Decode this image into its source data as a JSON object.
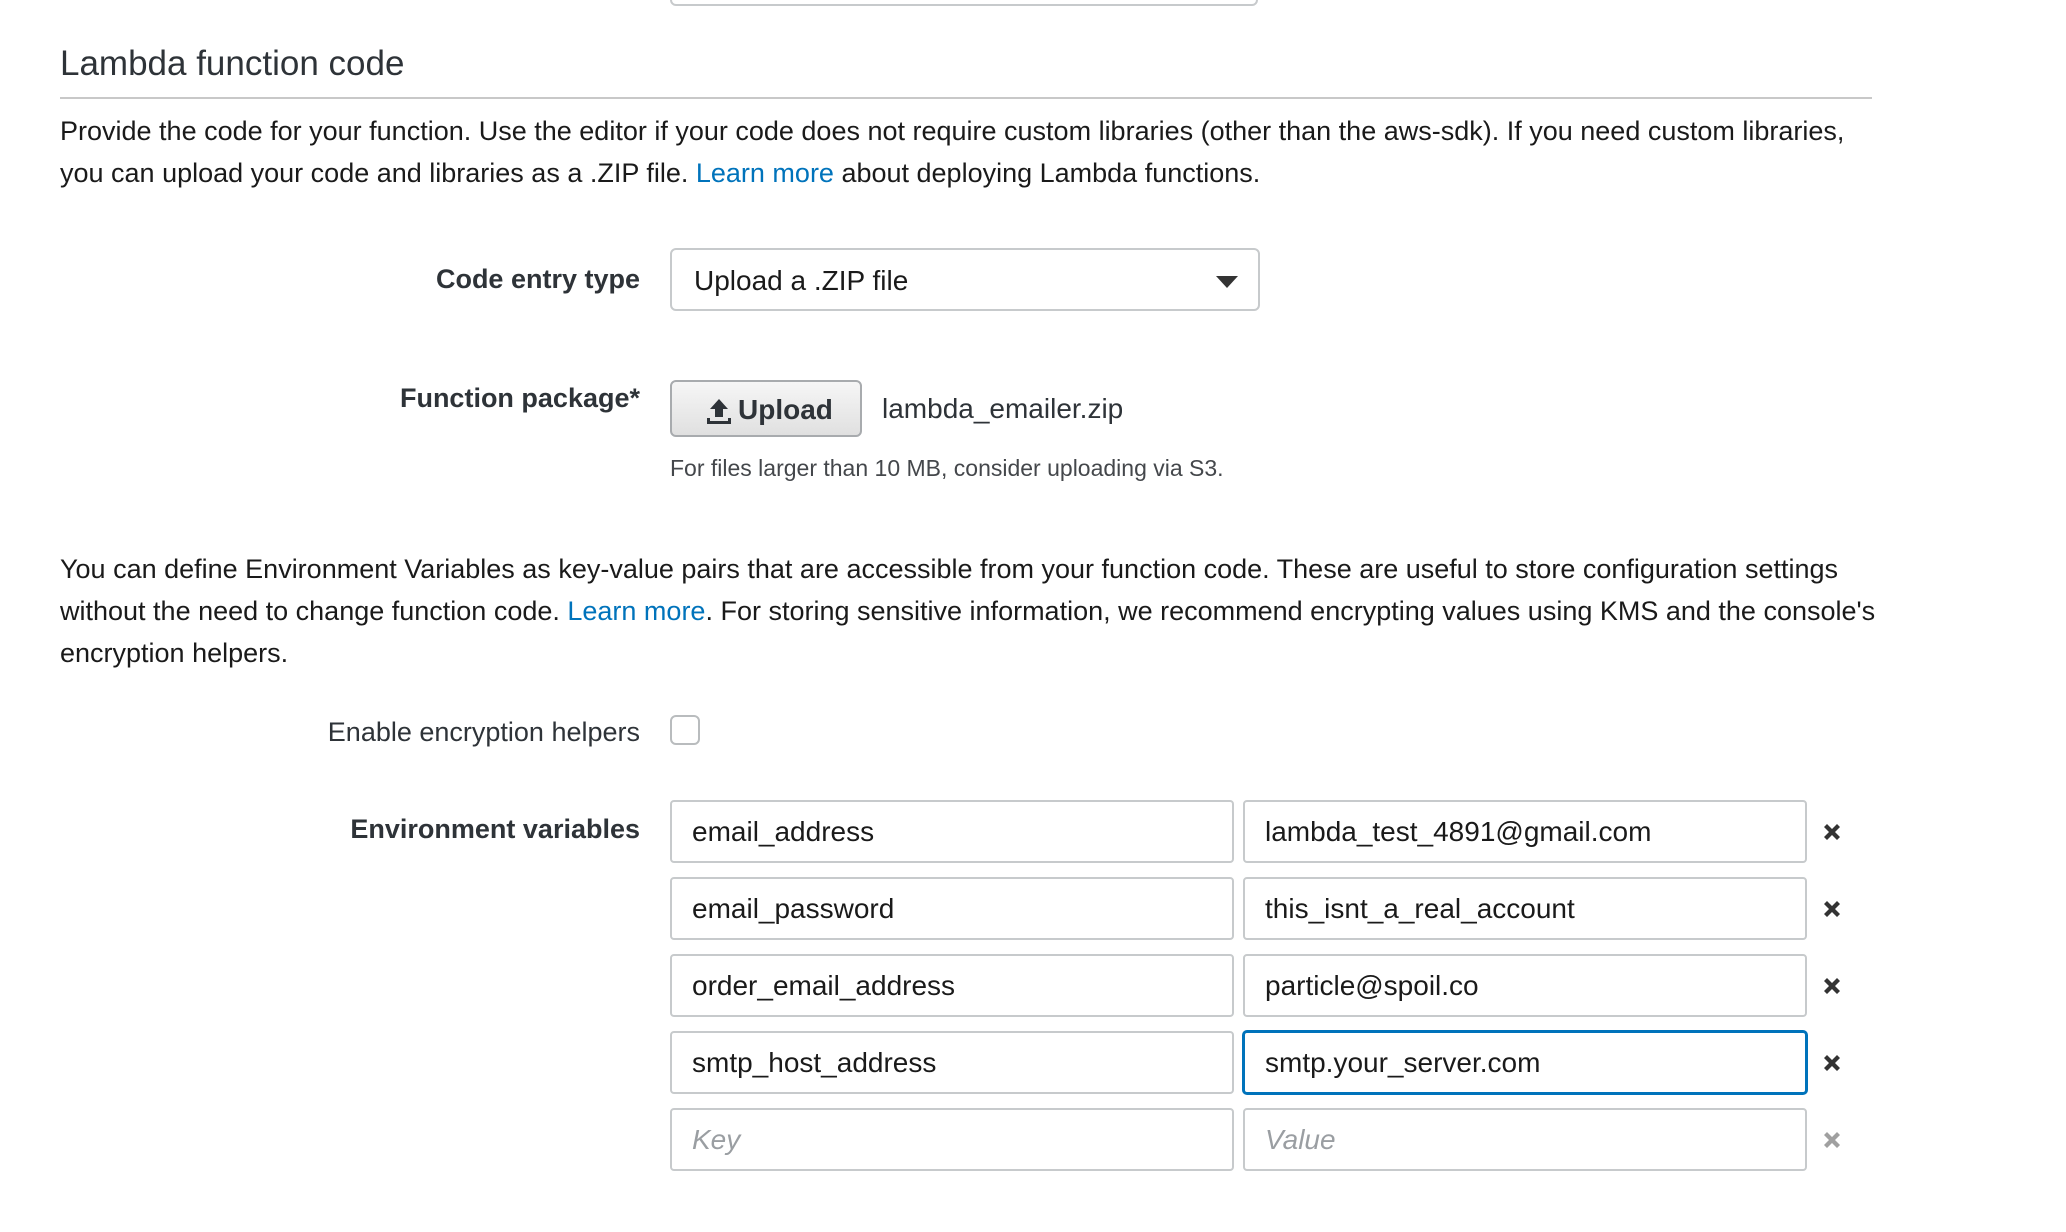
{
  "section": {
    "title": "Lambda function code",
    "intro_text_1": "Provide the code for your function. Use the editor if your code does not require custom libraries (other than the aws-sdk). If you need custom libraries, you can upload your code and libraries as a .ZIP file. ",
    "intro_link": "Learn more",
    "intro_text_2": " about deploying Lambda functions."
  },
  "code_entry": {
    "label": "Code entry type",
    "selected": "Upload a .ZIP file"
  },
  "function_package": {
    "label": "Function package*",
    "upload_label": "Upload",
    "filename": "lambda_emailer.zip",
    "hint": "For files larger than 10 MB, consider uploading via S3."
  },
  "env_intro": {
    "text_1": "You can define Environment Variables as key-value pairs that are accessible from your function code. These are useful to store configuration settings without the need to change function code. ",
    "link": "Learn more",
    "text_2": ". For storing sensitive information, we recommend encrypting values using KMS and the console's encryption helpers."
  },
  "encryption": {
    "label": "Enable encryption helpers",
    "checked": false
  },
  "env_vars": {
    "label": "Environment variables",
    "rows": [
      {
        "key": "email_address",
        "value": "lambda_test_4891@gmail.com"
      },
      {
        "key": "email_password",
        "value": "this_isnt_a_real_account"
      },
      {
        "key": "order_email_address",
        "value": "particle@spoil.co"
      },
      {
        "key": "smtp_host_address",
        "value": "smtp.your_server.com"
      }
    ],
    "key_placeholder": "Key",
    "value_placeholder": "Value"
  },
  "colors": {
    "link": "#0073bb",
    "focus": "#0073bb",
    "remove_active": "#333333",
    "remove_disabled": "#a0a0a0"
  },
  "icons": {
    "upload": "upload-arrow-icon",
    "remove": "close-x-icon",
    "dropdown": "caret-down-icon"
  }
}
